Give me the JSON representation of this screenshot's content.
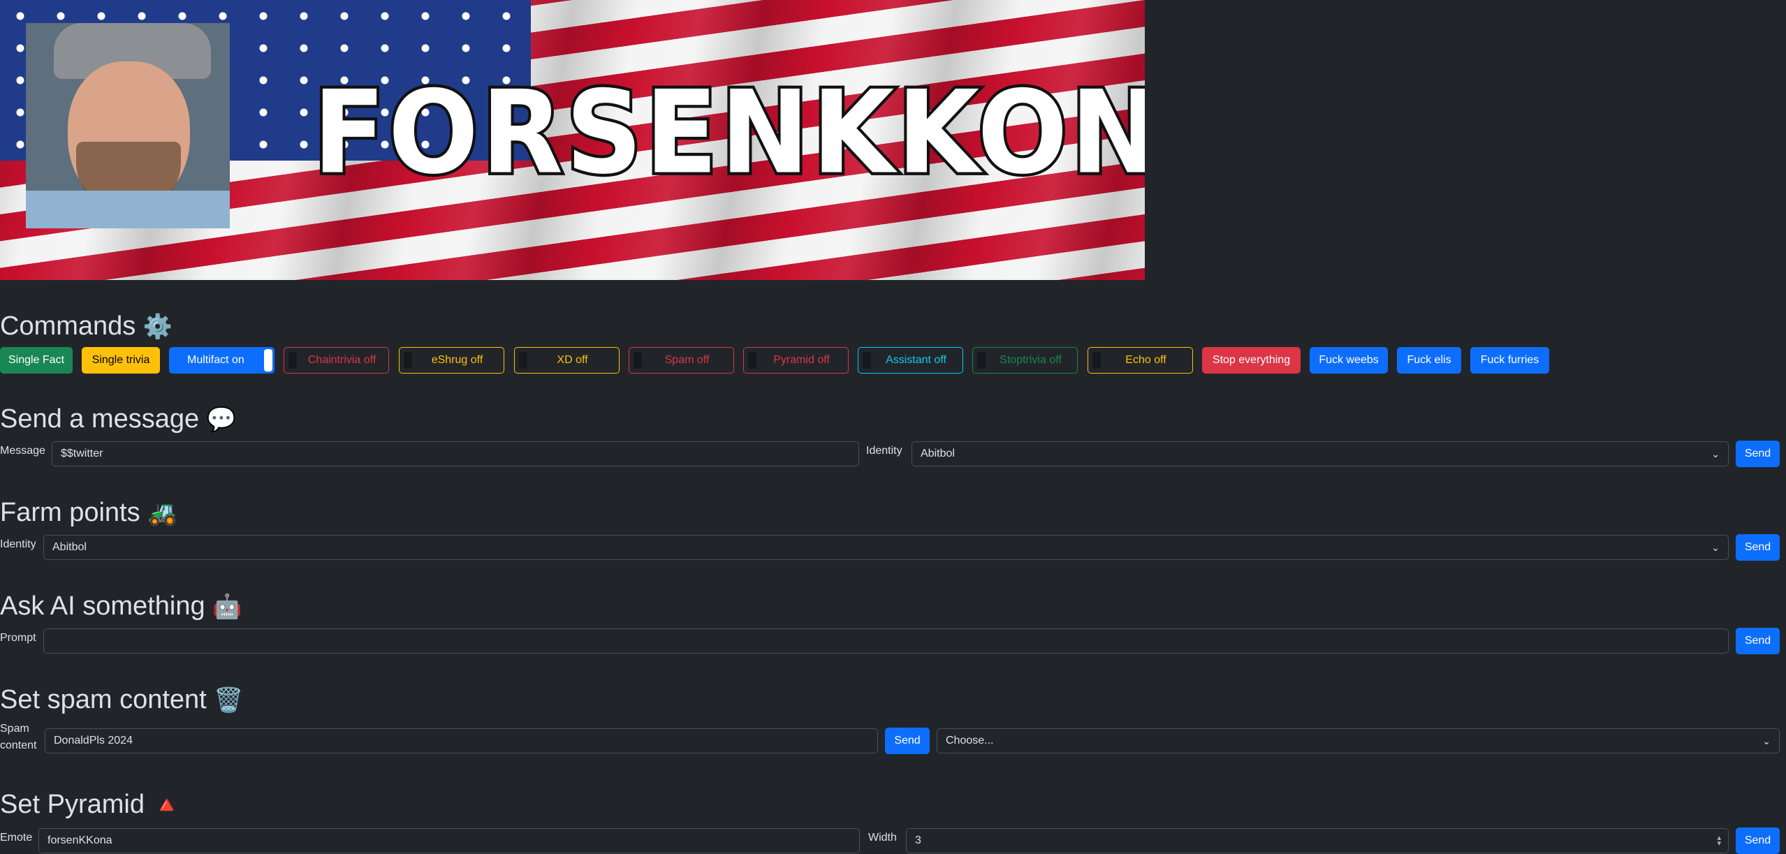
{
  "banner": {
    "title": "FORSENKKONA"
  },
  "commands": {
    "heading": "Commands",
    "heading_icon": "gear-icon",
    "buttons": {
      "single_fact": "Single Fact",
      "single_trivia": "Single trivia",
      "multifact": "Multifact on",
      "chaintrivia": "Chaintrivia off",
      "eshrug": "eShrug off",
      "xd": "XD off",
      "spam": "Spam off",
      "pyramid": "Pyramid off",
      "assistant": "Assistant off",
      "stoptrivia": "Stoptrivia off",
      "echo": "Echo off",
      "stop_everything": "Stop everything",
      "fuck_weebs": "Fuck weebs",
      "fuck_elis": "Fuck elis",
      "fuck_furries": "Fuck furries"
    },
    "colors": {
      "primary": "#0d6efd",
      "success": "#198754",
      "warning": "#ffc107",
      "danger": "#dc3545",
      "info": "#0dcaf0"
    }
  },
  "send_message": {
    "heading": "Send a message",
    "heading_icon": "speech-bubble-icon",
    "message_label": "Message",
    "message_value": "$$twitter",
    "identity_label": "Identity",
    "identity_value": "Abitbol",
    "send_label": "Send"
  },
  "farm_points": {
    "heading": "Farm points",
    "heading_icon": "tractor-icon",
    "identity_label": "Identity",
    "identity_value": "Abitbol",
    "send_label": "Send"
  },
  "ask_ai": {
    "heading": "Ask AI something",
    "heading_icon": "robot-icon",
    "prompt_label": "Prompt",
    "prompt_value": "",
    "send_label": "Send"
  },
  "spam_content": {
    "heading": "Set spam content",
    "heading_icon": "trash-can-icon",
    "label_line1": "Spam",
    "label_line2": "content",
    "value": "DonaldPls 2024",
    "send_label": "Send",
    "select_value": "Choose..."
  },
  "pyramid": {
    "heading": "Set Pyramid",
    "heading_icon": "red-triangle-icon",
    "emote_label": "Emote",
    "emote_value": "forsenKKona",
    "width_label": "Width",
    "width_value": "3",
    "send_label": "Send"
  }
}
